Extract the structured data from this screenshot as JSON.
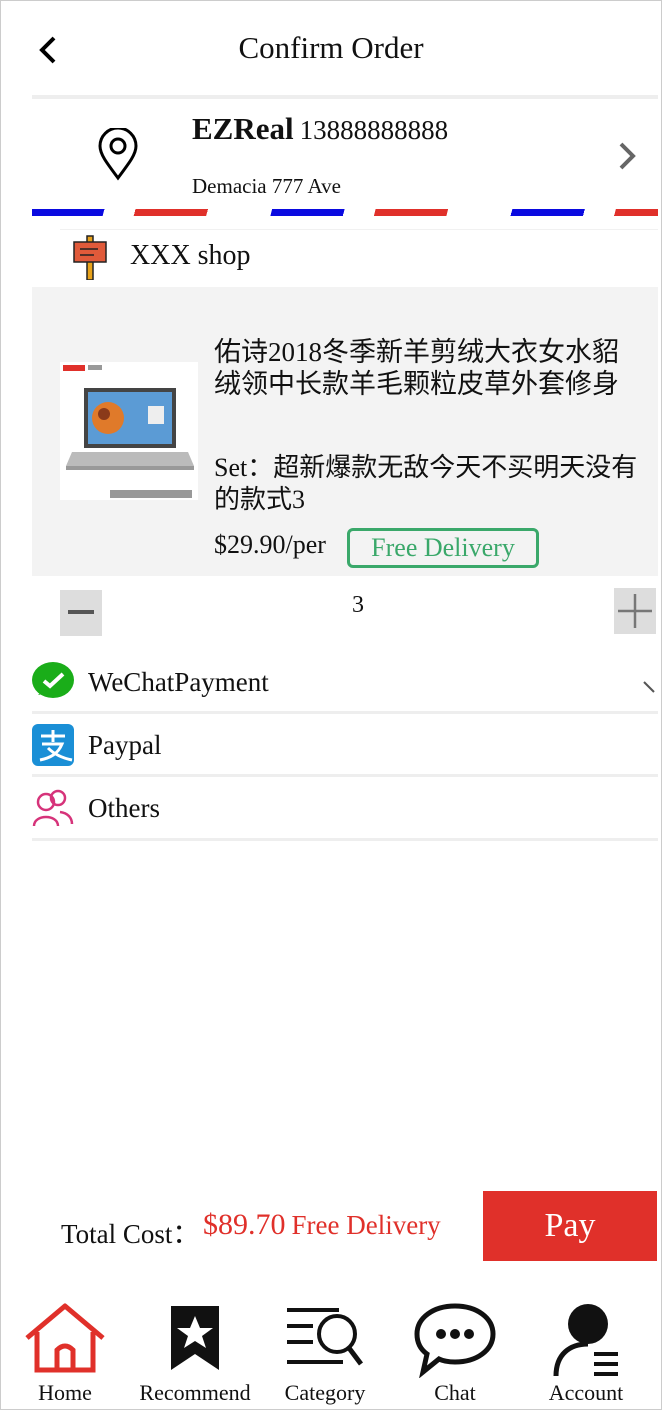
{
  "header": {
    "title": "Confirm Order",
    "back_icon": "chevron-left-icon"
  },
  "address": {
    "name": "EZReal",
    "phone": "13888888888",
    "street": "Demacia 777 Ave",
    "pin_icon": "location-pin-icon",
    "chevron_icon": "chevron-right-icon"
  },
  "shop": {
    "name": "XXX shop",
    "icon": "shop-sign-icon"
  },
  "product": {
    "title": "佑诗2018冬季新羊剪绒大衣女水貂绒领中长款羊毛颗粒皮草外套修身",
    "set": "Set：超新爆款无敌今天不买明天没有的款式3",
    "price": "$29.90/per",
    "delivery_badge": "Free Delivery"
  },
  "quantity": {
    "value": "3",
    "minus_icon": "minus-icon",
    "plus_icon": "plus-icon"
  },
  "payment_methods": [
    {
      "label": "WeChatPayment",
      "icon": "wechat-pay-icon",
      "selected": true
    },
    {
      "label": "Paypal",
      "icon": "alipay-icon"
    },
    {
      "label": "Others",
      "icon": "people-icon"
    }
  ],
  "footer": {
    "total_label": "Total Cost：",
    "total_value": "$89.70",
    "delivery_note": "Free Delivery",
    "pay_label": "Pay"
  },
  "tabbar": [
    {
      "label": "Home",
      "icon": "home-icon",
      "active": true
    },
    {
      "label": "Recommend",
      "icon": "bookmark-star-icon"
    },
    {
      "label": "Category",
      "icon": "category-search-icon"
    },
    {
      "label": "Chat",
      "icon": "chat-bubble-icon"
    },
    {
      "label": "Account",
      "icon": "account-icon"
    }
  ],
  "colors": {
    "accent": "#e0302a",
    "green": "#3aa86a",
    "wechat": "#1aad19",
    "alipay": "#1a8fd6",
    "others": "#d6337a"
  }
}
